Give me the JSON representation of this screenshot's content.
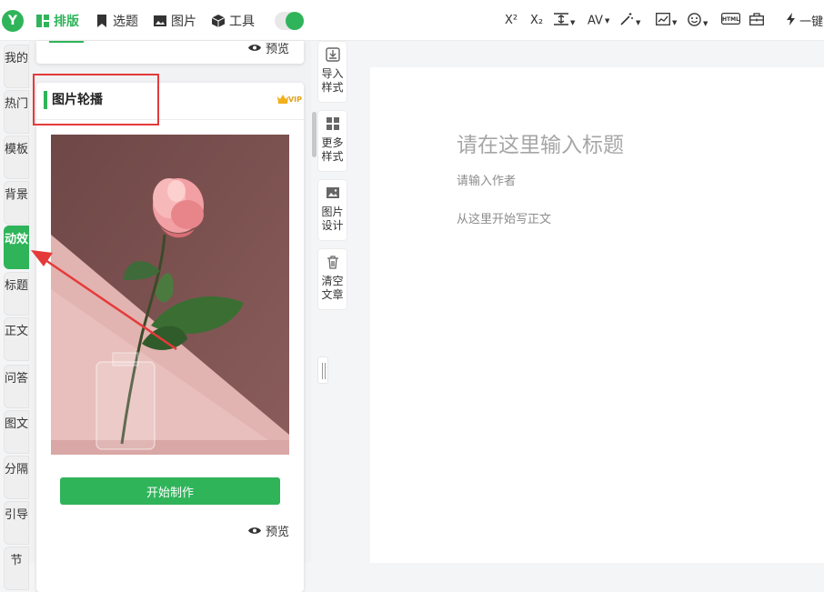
{
  "header": {
    "logo_text": "Y",
    "nav": [
      {
        "label": "排版",
        "icon": "layout-icon",
        "active": true
      },
      {
        "label": "选题",
        "icon": "bookmark-icon"
      },
      {
        "label": "图片",
        "icon": "image-icon"
      },
      {
        "label": "工具",
        "icon": "cube-icon"
      }
    ],
    "toolbar": {
      "superscript": "X²",
      "subscript": "X₂",
      "line_height": "↕",
      "letter_spacing": "AV",
      "one_click_label": "一键"
    }
  },
  "left_nav": [
    {
      "label": "我的"
    },
    {
      "label": "热门"
    },
    {
      "label": "模板"
    },
    {
      "label": "背景"
    },
    {
      "label": "动效",
      "active": true
    },
    {
      "label": "标题"
    },
    {
      "label": "正文"
    },
    {
      "label": "问答"
    },
    {
      "label": "图文"
    },
    {
      "label": "分隔"
    },
    {
      "label": "引导"
    },
    {
      "label": "节"
    }
  ],
  "panel": {
    "preview_label": "预览",
    "card": {
      "title": "图片轮播",
      "vip_label": "VIP",
      "start_button": "开始制作",
      "preview_label": "预览"
    }
  },
  "side_tools": [
    {
      "label": "导入样式",
      "icon": "import-icon"
    },
    {
      "label": "更多样式",
      "icon": "grid-icon"
    },
    {
      "label": "图片设计",
      "icon": "image-icon"
    },
    {
      "label": "清空文章",
      "icon": "trash-icon"
    }
  ],
  "editor": {
    "title_placeholder": "请在这里输入标题",
    "author_placeholder": "请输入作者",
    "body_placeholder": "从这里开始写正文"
  },
  "colors": {
    "accent": "#2fb45a",
    "annotation": "#e53a3a"
  }
}
